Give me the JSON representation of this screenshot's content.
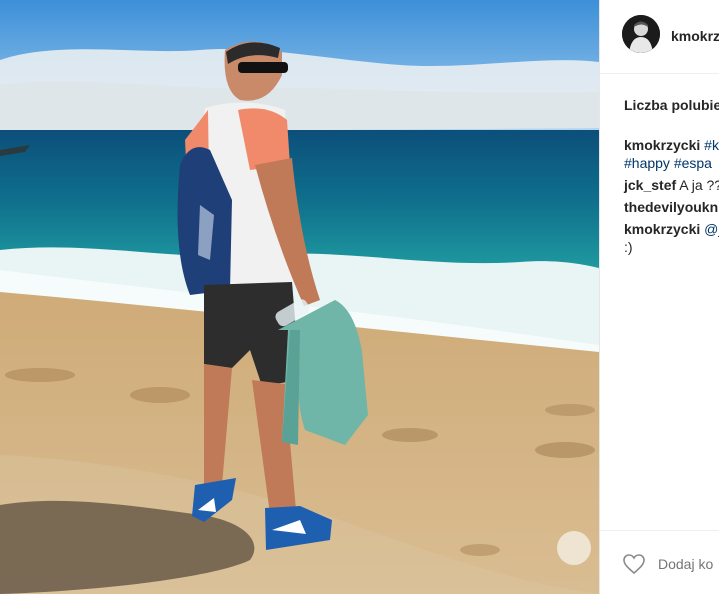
{
  "post": {
    "username": "kmokrz",
    "likes_text": "Liczba polubie",
    "comments": [
      {
        "author": "kmokrzycki",
        "parts": [
          {
            "text": "#k",
            "tag": true
          }
        ],
        "continuation": [
          {
            "text": "#happy",
            "tag": true
          },
          {
            "text": " ",
            "tag": false
          },
          {
            "text": "#espa",
            "tag": true
          }
        ]
      },
      {
        "author": "jck_stef",
        "parts": [
          {
            "text": " A ja ??",
            "tag": false
          }
        ]
      },
      {
        "author": "thedevilyoukn",
        "parts": []
      },
      {
        "author": "kmokrzycki",
        "parts": [
          {
            "text": " @j",
            "tag": true
          }
        ],
        "continuation": [
          {
            "text": ":)",
            "tag": false
          }
        ]
      }
    ],
    "add_comment_placeholder": "Dodaj ko"
  },
  "icons": {
    "avatar": "avatar-photo",
    "like": "heart-outline-icon",
    "watermark": "watermark-logo"
  },
  "colors": {
    "link": "#003569",
    "text": "#262626",
    "muted": "#999999"
  }
}
